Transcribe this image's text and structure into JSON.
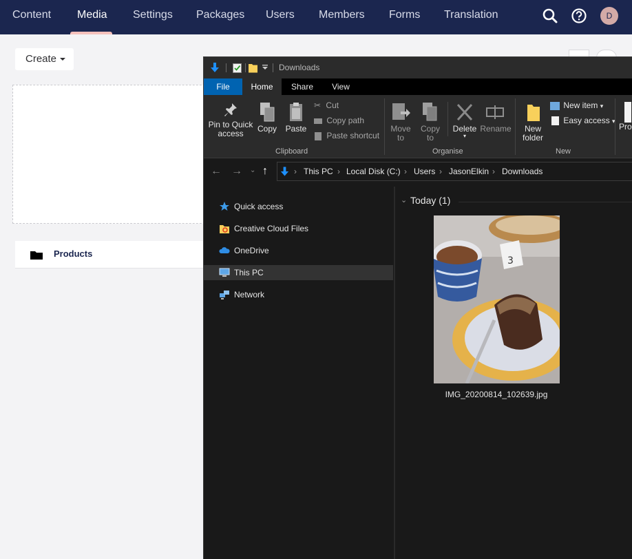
{
  "topnav": {
    "items": [
      "Content",
      "Media",
      "Settings",
      "Packages",
      "Users",
      "Members",
      "Forms",
      "Translation"
    ],
    "active": "Media",
    "avatar_initial": "D"
  },
  "media": {
    "create_label": "Create",
    "folder_name": "Products"
  },
  "explorer": {
    "title": "Downloads",
    "tabs": [
      "File",
      "Home",
      "Share",
      "View"
    ],
    "ribbon": {
      "clipboard": {
        "pin_line1": "Pin to Quick",
        "pin_line2": "access",
        "copy": "Copy",
        "paste": "Paste",
        "cut": "Cut",
        "copy_path": "Copy path",
        "paste_shortcut": "Paste shortcut",
        "label": "Clipboard"
      },
      "organise": {
        "move_line1": "Move",
        "move_line2": "to",
        "copyto_line1": "Copy",
        "copyto_line2": "to",
        "delete": "Delete",
        "rename": "Rename",
        "label": "Organise"
      },
      "new": {
        "folder_line1": "New",
        "folder_line2": "folder",
        "new_item": "New item",
        "easy_access": "Easy access",
        "label": "New"
      },
      "open": {
        "properties_partial": "Pro"
      }
    },
    "address": {
      "crumbs": [
        "This PC",
        "Local Disk (C:)",
        "Users",
        "JasonElkin",
        "Downloads"
      ]
    },
    "nav": {
      "items": [
        "Quick access",
        "Creative Cloud Files",
        "OneDrive",
        "This PC",
        "Network"
      ],
      "selected": "This PC"
    },
    "content": {
      "group_header": "Today (1)",
      "file_name": "IMG_20200814_102639.jpg",
      "photo_number_card": "3"
    }
  },
  "colors": {
    "topbar": "#1b264f",
    "active_underline": "#f5c1bc",
    "file_tab": "#0063b1",
    "explorer_bg": "#191919"
  }
}
